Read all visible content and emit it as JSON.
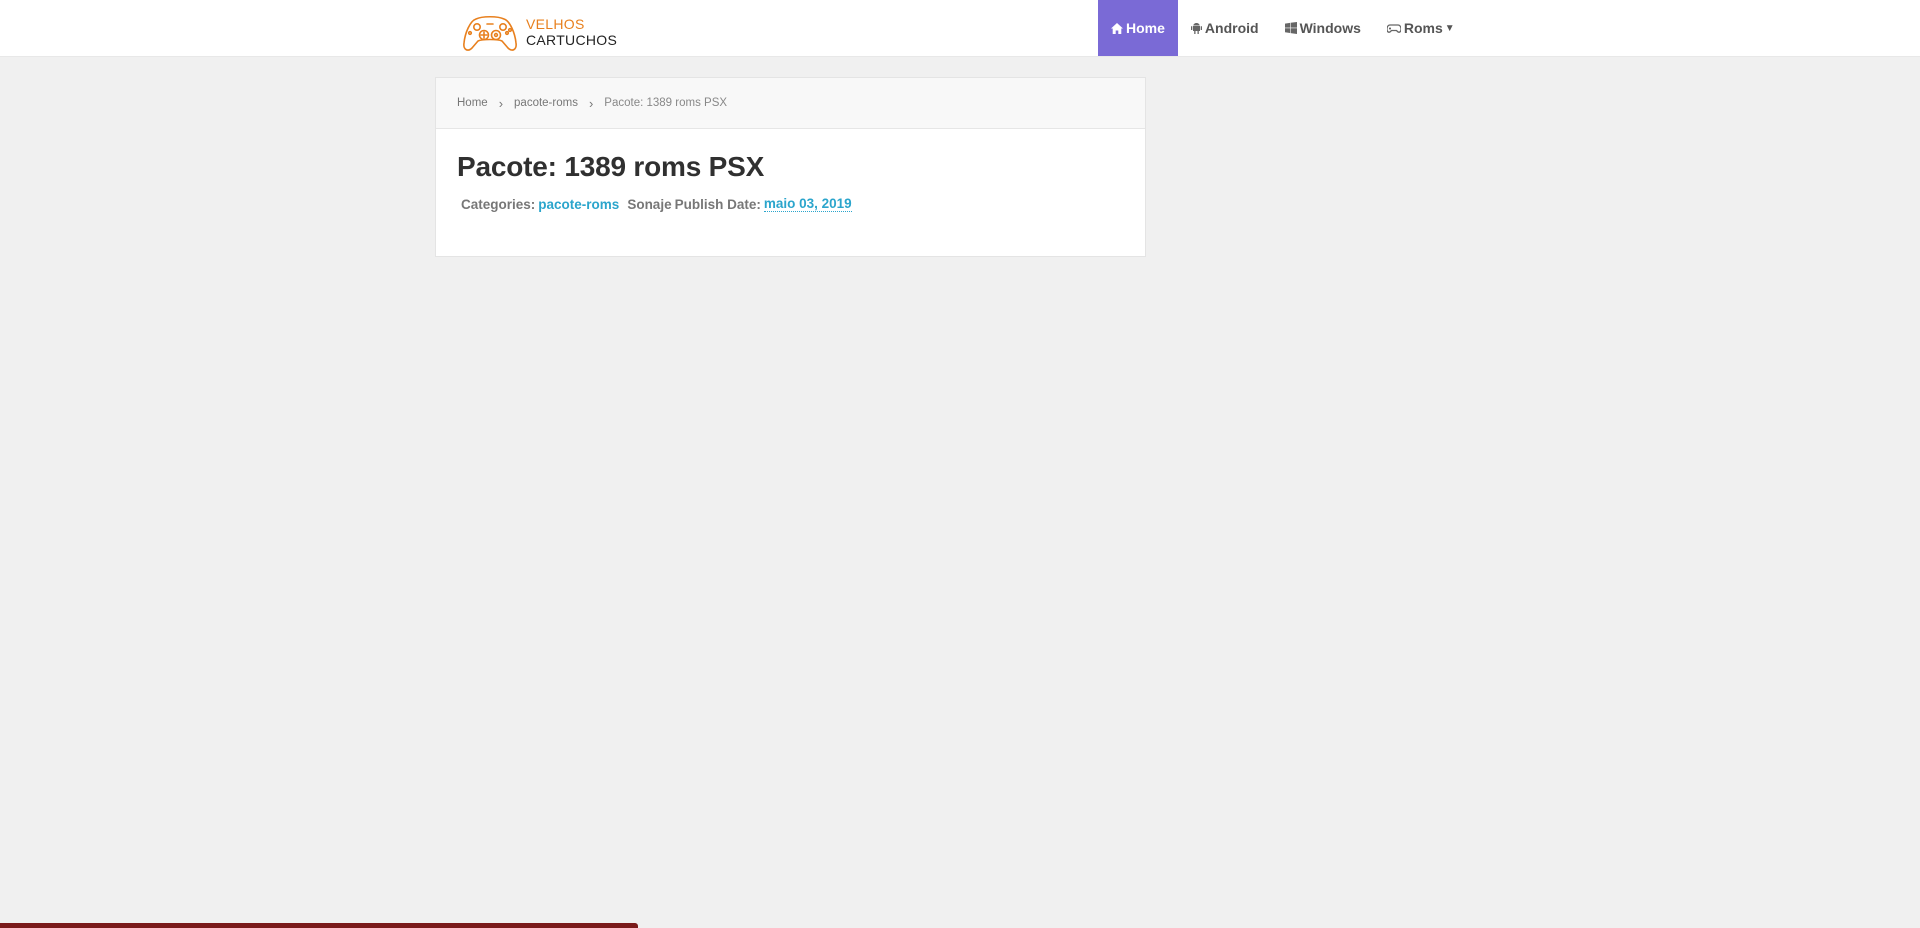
{
  "header": {
    "logo": {
      "line1": "VELHOS",
      "line2": "CARTUCHOS",
      "icon": "gamepad-icon",
      "color": "#e8801e"
    },
    "nav": [
      {
        "label": "Home",
        "icon": "home-icon",
        "active": true
      },
      {
        "label": "Android",
        "icon": "android-icon",
        "active": false
      },
      {
        "label": "Windows",
        "icon": "windows-icon",
        "active": false
      },
      {
        "label": "Roms",
        "icon": "gamepad-icon",
        "active": false,
        "dropdown": true
      }
    ],
    "active_color": "#7a6ad6"
  },
  "breadcrumb": {
    "items": [
      "Home",
      "pacote-roms"
    ],
    "current": "Pacote: 1389 roms PSX"
  },
  "post": {
    "title": "Pacote: 1389 roms PSX",
    "categories_label": "Categories:",
    "category": "pacote-roms",
    "author": "Sonaje",
    "date_label": "Publish Date:",
    "date": "maio 03, 2019",
    "link_color": "#2ba5cc"
  }
}
